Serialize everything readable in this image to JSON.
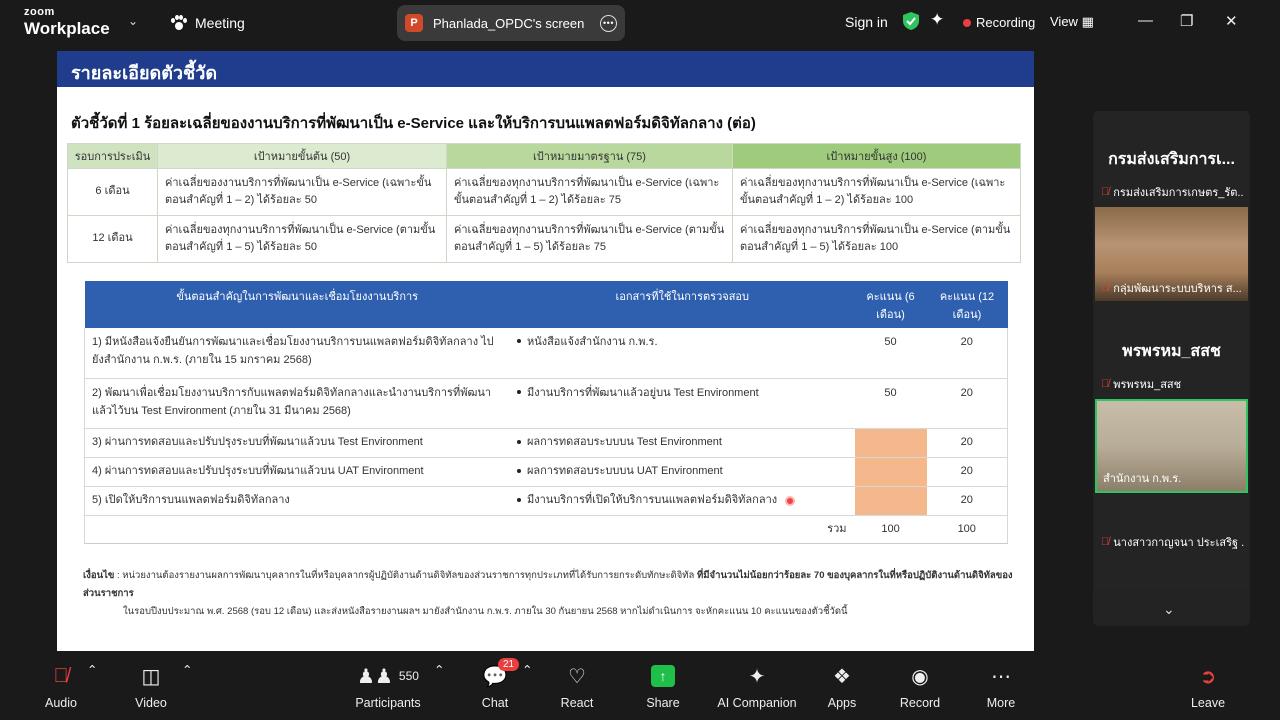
{
  "topbar": {
    "brand_zoom": "zoom",
    "brand_workplace": "Workplace",
    "meeting_label": "Meeting",
    "share_label": "Phanlada_OPDC's screen",
    "signin_label": "Sign in",
    "recording_label": "Recording",
    "view_label": "View"
  },
  "slide": {
    "banner": "รายละเอียดตัวชี้วัด",
    "indicator_title": "ตัวชี้วัดที่ 1 ร้อยละเฉลี่ยของงานบริการที่พัฒนาเป็น e-Service และให้บริการบนแพลตฟอร์มดิจิทัลกลาง (ต่อ)",
    "target_table": {
      "headers": [
        "รอบการประเมิน",
        "เป้าหมายขั้นต้น (50)",
        "เป้าหมายมาตรฐาน (75)",
        "เป้าหมายขั้นสูง (100)"
      ],
      "rows": [
        [
          "6 เดือน",
          "ค่าเฉลี่ยของงานบริการที่พัฒนาเป็น e-Service (เฉพาะขั้นตอนสำคัญที่ 1 – 2) ได้ร้อยละ 50",
          "ค่าเฉลี่ยของทุกงานบริการที่พัฒนาเป็น e-Service (เฉพาะขั้นตอนสำคัญที่ 1 – 2) ได้ร้อยละ 75",
          "ค่าเฉลี่ยของทุกงานบริการที่พัฒนาเป็น e-Service (เฉพาะขั้นตอนสำคัญที่ 1 – 2) ได้ร้อยละ 100"
        ],
        [
          "12 เดือน",
          "ค่าเฉลี่ยของทุกงานบริการที่พัฒนาเป็น e-Service (ตามขั้นตอนสำคัญที่ 1 – 5) ได้ร้อยละ 50",
          "ค่าเฉลี่ยของทุกงานบริการที่พัฒนาเป็น e-Service (ตามขั้นตอนสำคัญที่ 1 – 5) ได้ร้อยละ 75",
          "ค่าเฉลี่ยของทุกงานบริการที่พัฒนาเป็น e-Service (ตามขั้นตอนสำคัญที่ 1 – 5) ได้ร้อยละ 100"
        ]
      ]
    },
    "steps_table": {
      "headers": [
        "ขั้นตอนสำคัญในการพัฒนาและเชื่อมโยงงานบริการ",
        "เอกสารที่ใช้ในการตรวจสอบ",
        "คะแนน (6 เดือน)",
        "คะแนน (12 เดือน)"
      ],
      "rows": [
        {
          "step": "1) มีหนังสือแจ้งยืนยันการพัฒนาและเชื่อมโยงงานบริการบนแพลตฟอร์มดิจิทัลกลาง ไปยังสำนักงาน ก.พ.ร. (ภายใน 15 มกราคม 2568)",
          "doc": "หนังสือแจ้งสำนักงาน ก.พ.ร.",
          "s6": "50",
          "s12": "20"
        },
        {
          "step": "2) พัฒนาเพื่อเชื่อมโยงงานบริการกับแพลตฟอร์มดิจิทัลกลางและนำงานบริการที่พัฒนาแล้วไว้บน Test Environment (ภายใน 31 มีนาคม 2568)",
          "doc": "มีงานบริการที่พัฒนาแล้วอยู่บน Test Environment",
          "s6": "50",
          "s12": "20"
        },
        {
          "step": "3) ผ่านการทดสอบและปรับปรุงระบบที่พัฒนาแล้วบน Test Environment",
          "doc": "ผลการทดสอบระบบบน Test Environment",
          "s6": "",
          "s12": "20"
        },
        {
          "step": "4) ผ่านการทดสอบและปรับปรุงระบบที่พัฒนาแล้วบน UAT Environment",
          "doc": "ผลการทดสอบระบบบน UAT Environment",
          "s6": "",
          "s12": "20"
        },
        {
          "step": "5) เปิดให้บริการบนแพลตฟอร์มดิจิทัลกลาง",
          "doc": "มีงานบริการที่เปิดให้บริการบนแพลตฟอร์มดิจิทัลกลาง",
          "s6": "",
          "s12": "20"
        }
      ],
      "total_label": "รวม",
      "total_6": "100",
      "total_12": "100"
    },
    "condition_label": "เงื่อนไข",
    "condition_text_1": " : หน่วยงานต้องรายงานผลการพัฒนาบุคลากรในที่หรือบุคลากรผู้ปฏิบัติงานด้านดิจิทัลของส่วนราชการทุกประเภทที่ได้รับการยกระดับทักษะดิจิทัล ",
    "condition_bold": "ที่มีจำนวนไม่น้อยกว่าร้อยละ 70 ของบุคลากรในที่หรือปฏิบัติงานด้านดิจิทัลของส่วนราชการ",
    "condition_text_2": "ในรอบปีงบประมาณ พ.ศ. 2568 (รอบ 12 เดือน) และส่งหนังสือรายงานผลฯ มายังสำนักงาน ก.พ.ร. ภายใน 30 กันยายน 2568  หากไม่ดำเนินการ จะหักคะแนน 10 คะแนนของตัวชี้วัดนี้"
  },
  "gallery": {
    "tiles": [
      {
        "big": "กรมส่งเสริมการเ...",
        "name": "กรมส่งเสริมการเกษตร_รัต..."
      },
      {
        "big": "",
        "name": "กลุ่มพัฒนาระบบบริหาร ส..."
      },
      {
        "big": "พรพรหม_สสช",
        "name": "พรพรหม_สสช"
      },
      {
        "big": "",
        "name": "สำนักงาน ก.พ.ร."
      },
      {
        "big": "",
        "name": "นางสาวกาญจนา ประเสริฐ ..."
      }
    ]
  },
  "toolbar": {
    "audio": "Audio",
    "video": "Video",
    "participants_count": "550",
    "participants": "Participants",
    "chat_badge": "21",
    "chat": "Chat",
    "react": "React",
    "share": "Share",
    "ai": "AI Companion",
    "apps": "Apps",
    "record": "Record",
    "more": "More",
    "leave": "Leave"
  },
  "colors": {
    "banner": "#1f3d8c",
    "steps_header": "#2f60b0",
    "score_highlight": "#f4b88c",
    "active_speaker": "#2fc45f",
    "recording": "#e8403e"
  }
}
